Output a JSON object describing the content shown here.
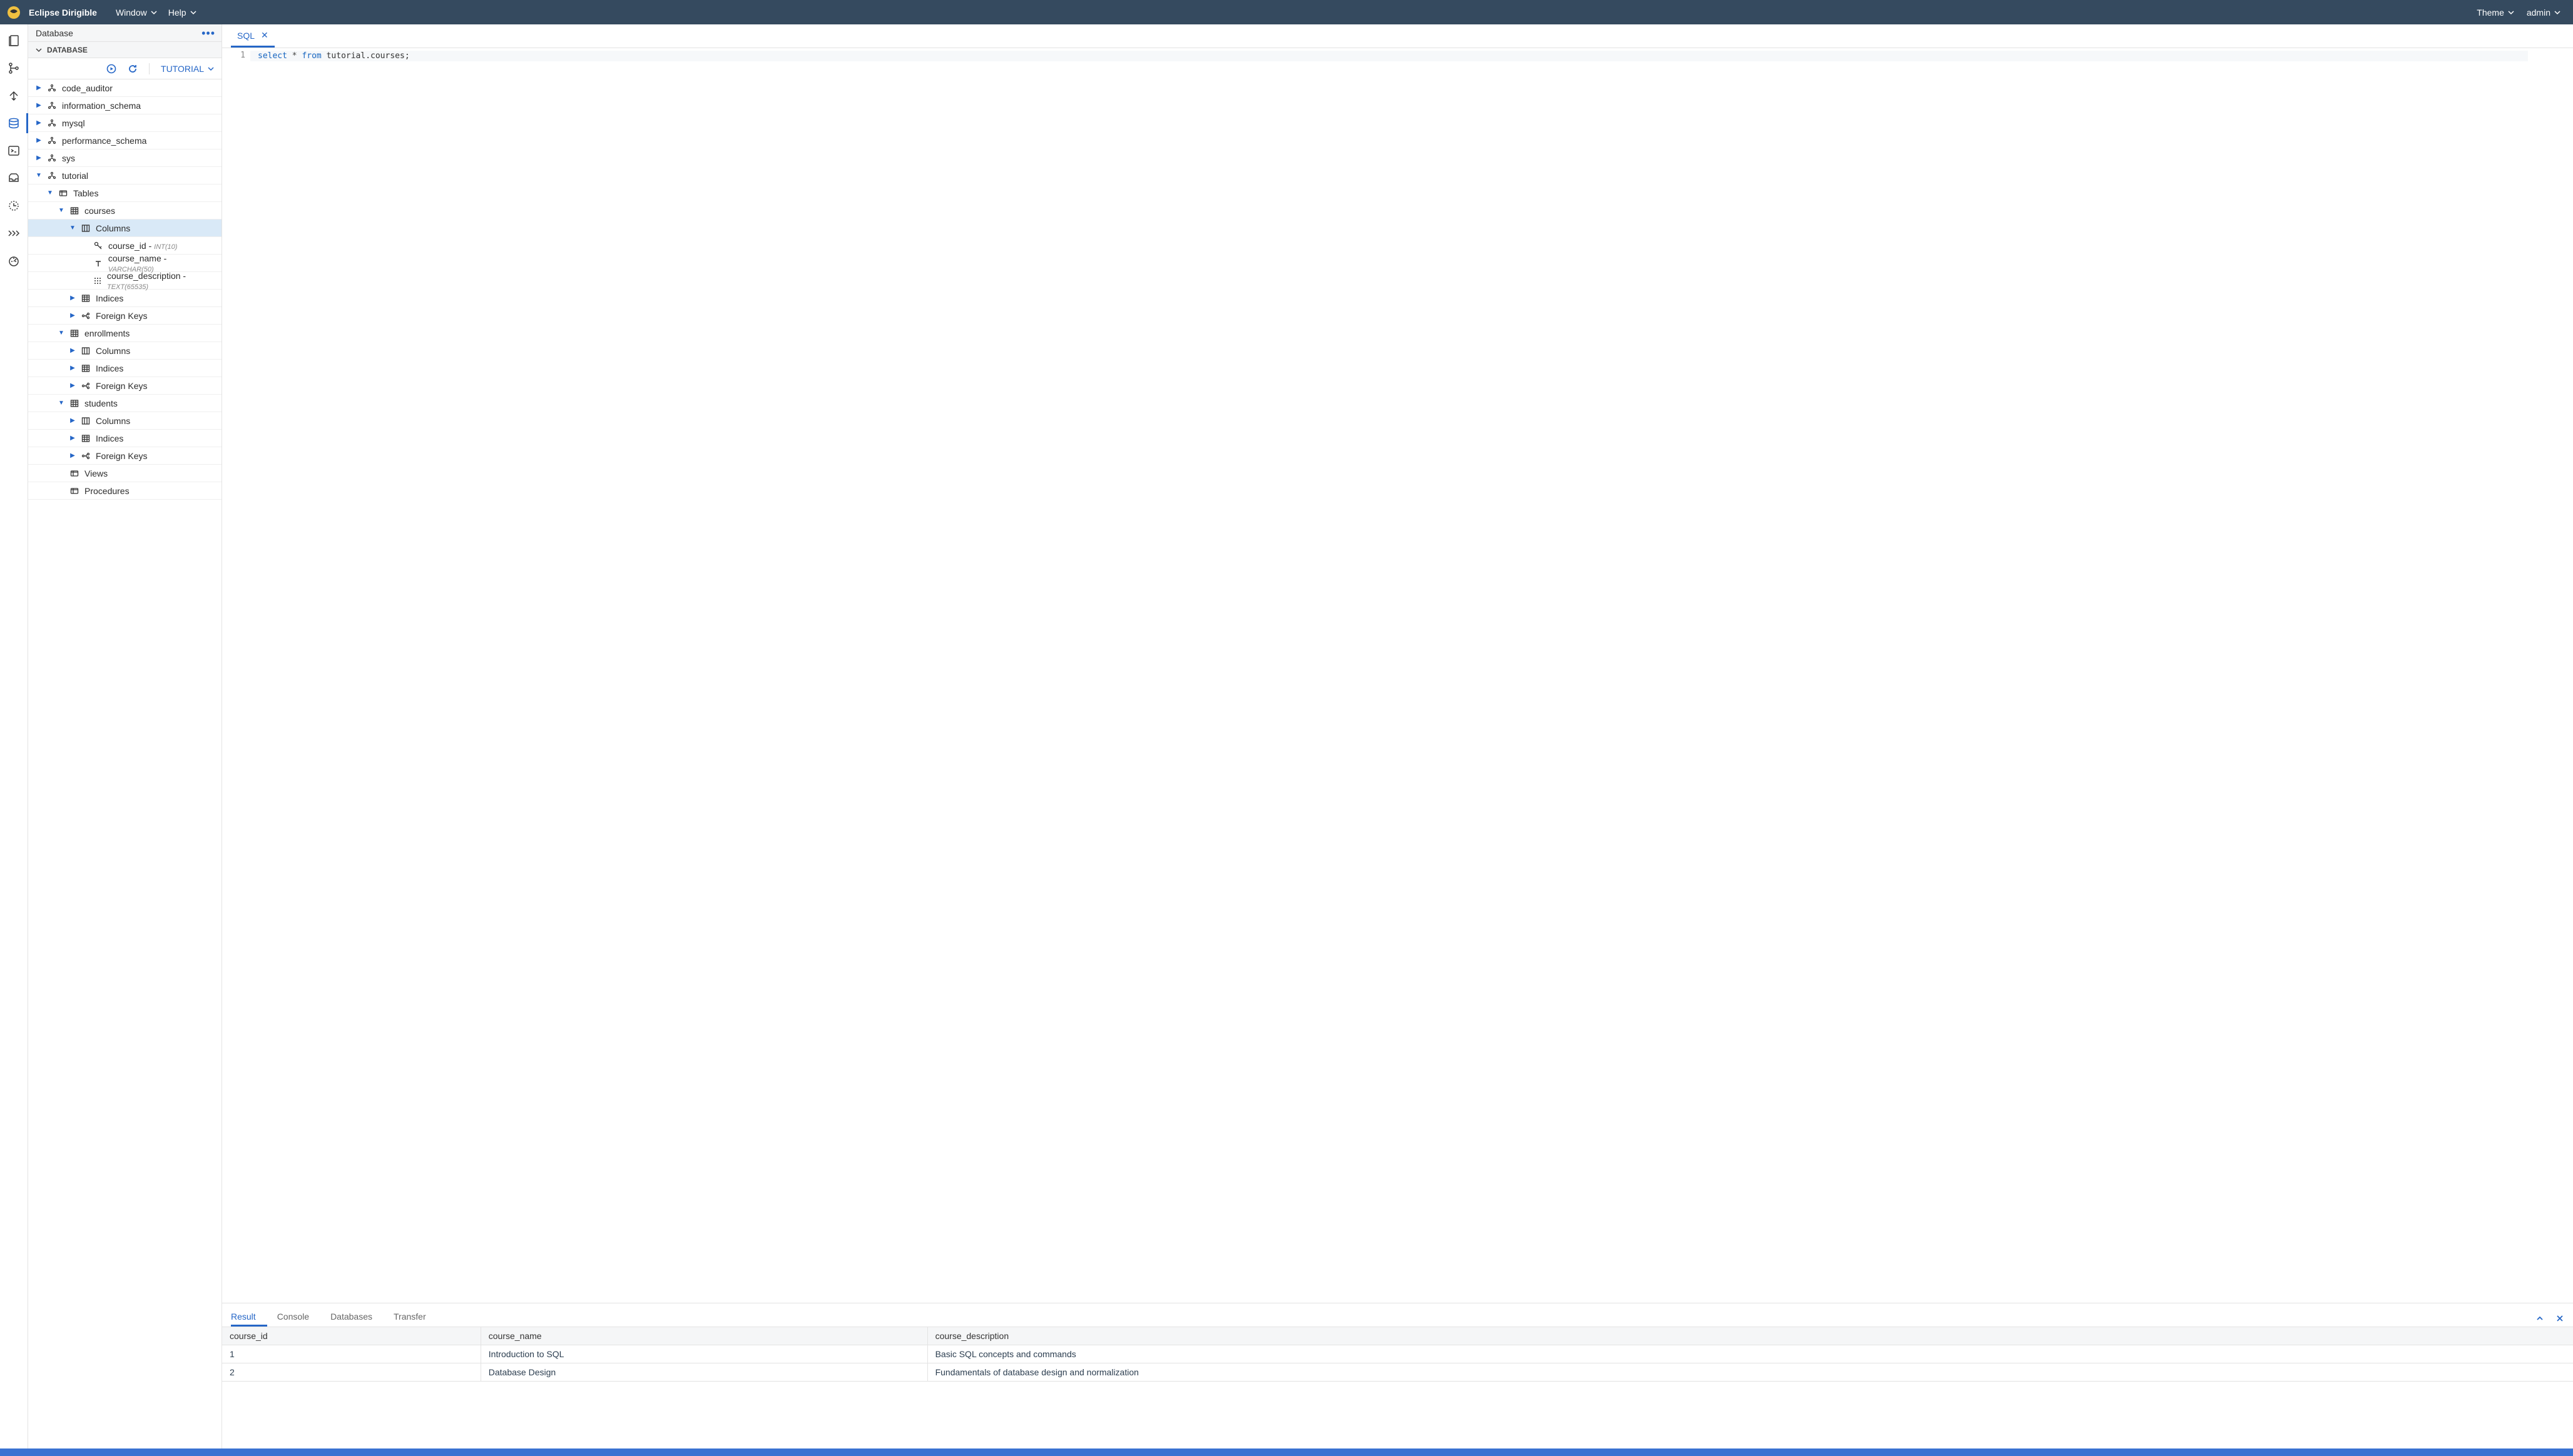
{
  "header": {
    "title": "Eclipse Dirigible",
    "menus": [
      "Window",
      "Help"
    ],
    "right": [
      "Theme",
      "admin"
    ]
  },
  "sidebar": {
    "title": "Database",
    "section": "DATABASE",
    "selected_db": "TUTORIAL",
    "tree": {
      "schemas": [
        {
          "name": "code_auditor",
          "expanded": false
        },
        {
          "name": "information_schema",
          "expanded": false
        },
        {
          "name": "mysql",
          "expanded": false
        },
        {
          "name": "performance_schema",
          "expanded": false
        },
        {
          "name": "sys",
          "expanded": false
        }
      ],
      "tutorial": {
        "name": "tutorial",
        "tables_label": "Tables",
        "views_label": "Views",
        "procedures_label": "Procedures",
        "tables": [
          {
            "name": "courses",
            "columns_label": "Columns",
            "indices_label": "Indices",
            "fks_label": "Foreign Keys",
            "columns": [
              {
                "name": "course_id",
                "type": "INT(10)",
                "icon": "key"
              },
              {
                "name": "course_name",
                "type": "VARCHAR(50)",
                "icon": "text"
              },
              {
                "name": "course_description",
                "type": "TEXT(65535)",
                "icon": "dots"
              }
            ]
          },
          {
            "name": "enrollments",
            "columns_label": "Columns",
            "indices_label": "Indices",
            "fks_label": "Foreign Keys"
          },
          {
            "name": "students",
            "columns_label": "Columns",
            "indices_label": "Indices",
            "fks_label": "Foreign Keys"
          }
        ]
      }
    }
  },
  "editor": {
    "tab": "SQL",
    "code_kw_select": "select",
    "code_star": "*",
    "code_kw_from": "from",
    "code_rest": "tutorial.courses;",
    "line_no": "1"
  },
  "bottom": {
    "tabs": [
      "Result",
      "Console",
      "Databases",
      "Transfer"
    ],
    "columns": [
      "course_id",
      "course_name",
      "course_description"
    ],
    "rows": [
      {
        "c0": "1",
        "c1": "Introduction to SQL",
        "c2": "Basic SQL concepts and commands"
      },
      {
        "c0": "2",
        "c1": "Database Design",
        "c2": "Fundamentals of database design and normalization"
      }
    ]
  }
}
